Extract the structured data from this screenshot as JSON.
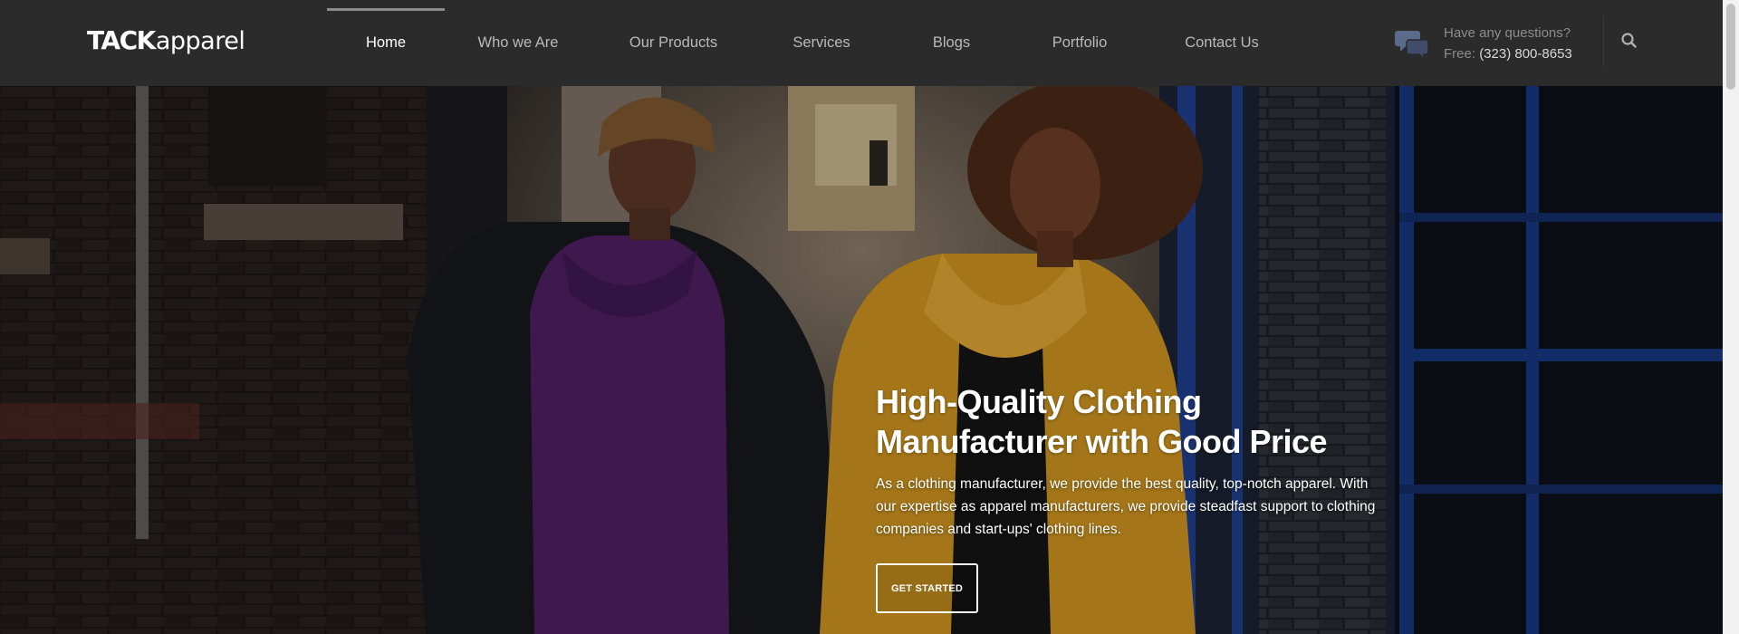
{
  "header": {
    "logo_strong": "TACK",
    "logo_light": "apparel",
    "nav": [
      {
        "label": "Home",
        "active": true
      },
      {
        "label": "Who we Are",
        "active": false
      },
      {
        "label": "Our Products",
        "active": false
      },
      {
        "label": "Services",
        "active": false
      },
      {
        "label": "Blogs",
        "active": false
      },
      {
        "label": "Portfolio",
        "active": false
      },
      {
        "label": "Contact Us",
        "active": false
      }
    ],
    "contact": {
      "question": "Have any questions?",
      "phone_prefix": "Free:",
      "phone": "(323) 800-8653",
      "icon": "chat-bubbles-icon"
    },
    "search_icon": "search-icon"
  },
  "hero": {
    "title": "High-Quality Clothing Manufacturer with Good Price",
    "description": "As a clothing manufacturer, we provide the best quality, top-notch apparel. With our expertise as apparel manufacturers, we provide steadfast support to clothing companies and start-ups' clothing lines.",
    "cta_label": "GET STARTED"
  },
  "colors": {
    "header_bg": "#2b2b2b",
    "nav_text": "#b9b9b9",
    "nav_active": "#ffffff",
    "chat_icon": "#5b6b8c",
    "hero_text": "#ffffff"
  }
}
